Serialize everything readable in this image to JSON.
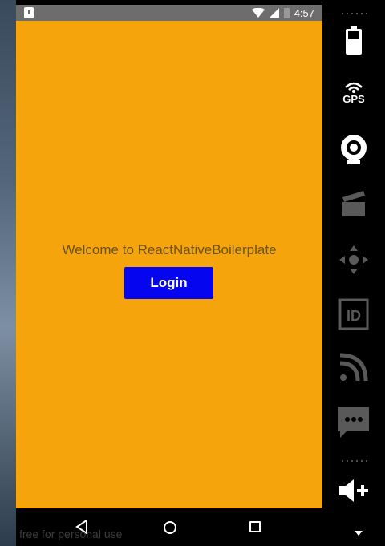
{
  "status_bar": {
    "time": "4:57",
    "alert_icon": "alert-icon",
    "wifi_icon": "wifi-icon",
    "signal_icon": "signal-icon",
    "battery_icon": "battery-icon"
  },
  "app": {
    "welcome_text": "Welcome to ReactNativeBoilerplate",
    "login_label": "Login",
    "background_color": "#f5a40c",
    "button_color": "#0505f0"
  },
  "nav_bar": {
    "back_icon": "back-triangle-icon",
    "home_icon": "home-circle-icon",
    "recents_icon": "recents-square-icon"
  },
  "watermark": "free for personal use",
  "emulator_toolbar": {
    "gps_label": "GPS",
    "items": [
      "battery-icon",
      "gps-icon",
      "camera-icon",
      "media-icon",
      "dpad-icon",
      "id-icon",
      "cast-icon",
      "sms-icon",
      "volume-up-icon"
    ],
    "id_text": "ID"
  }
}
